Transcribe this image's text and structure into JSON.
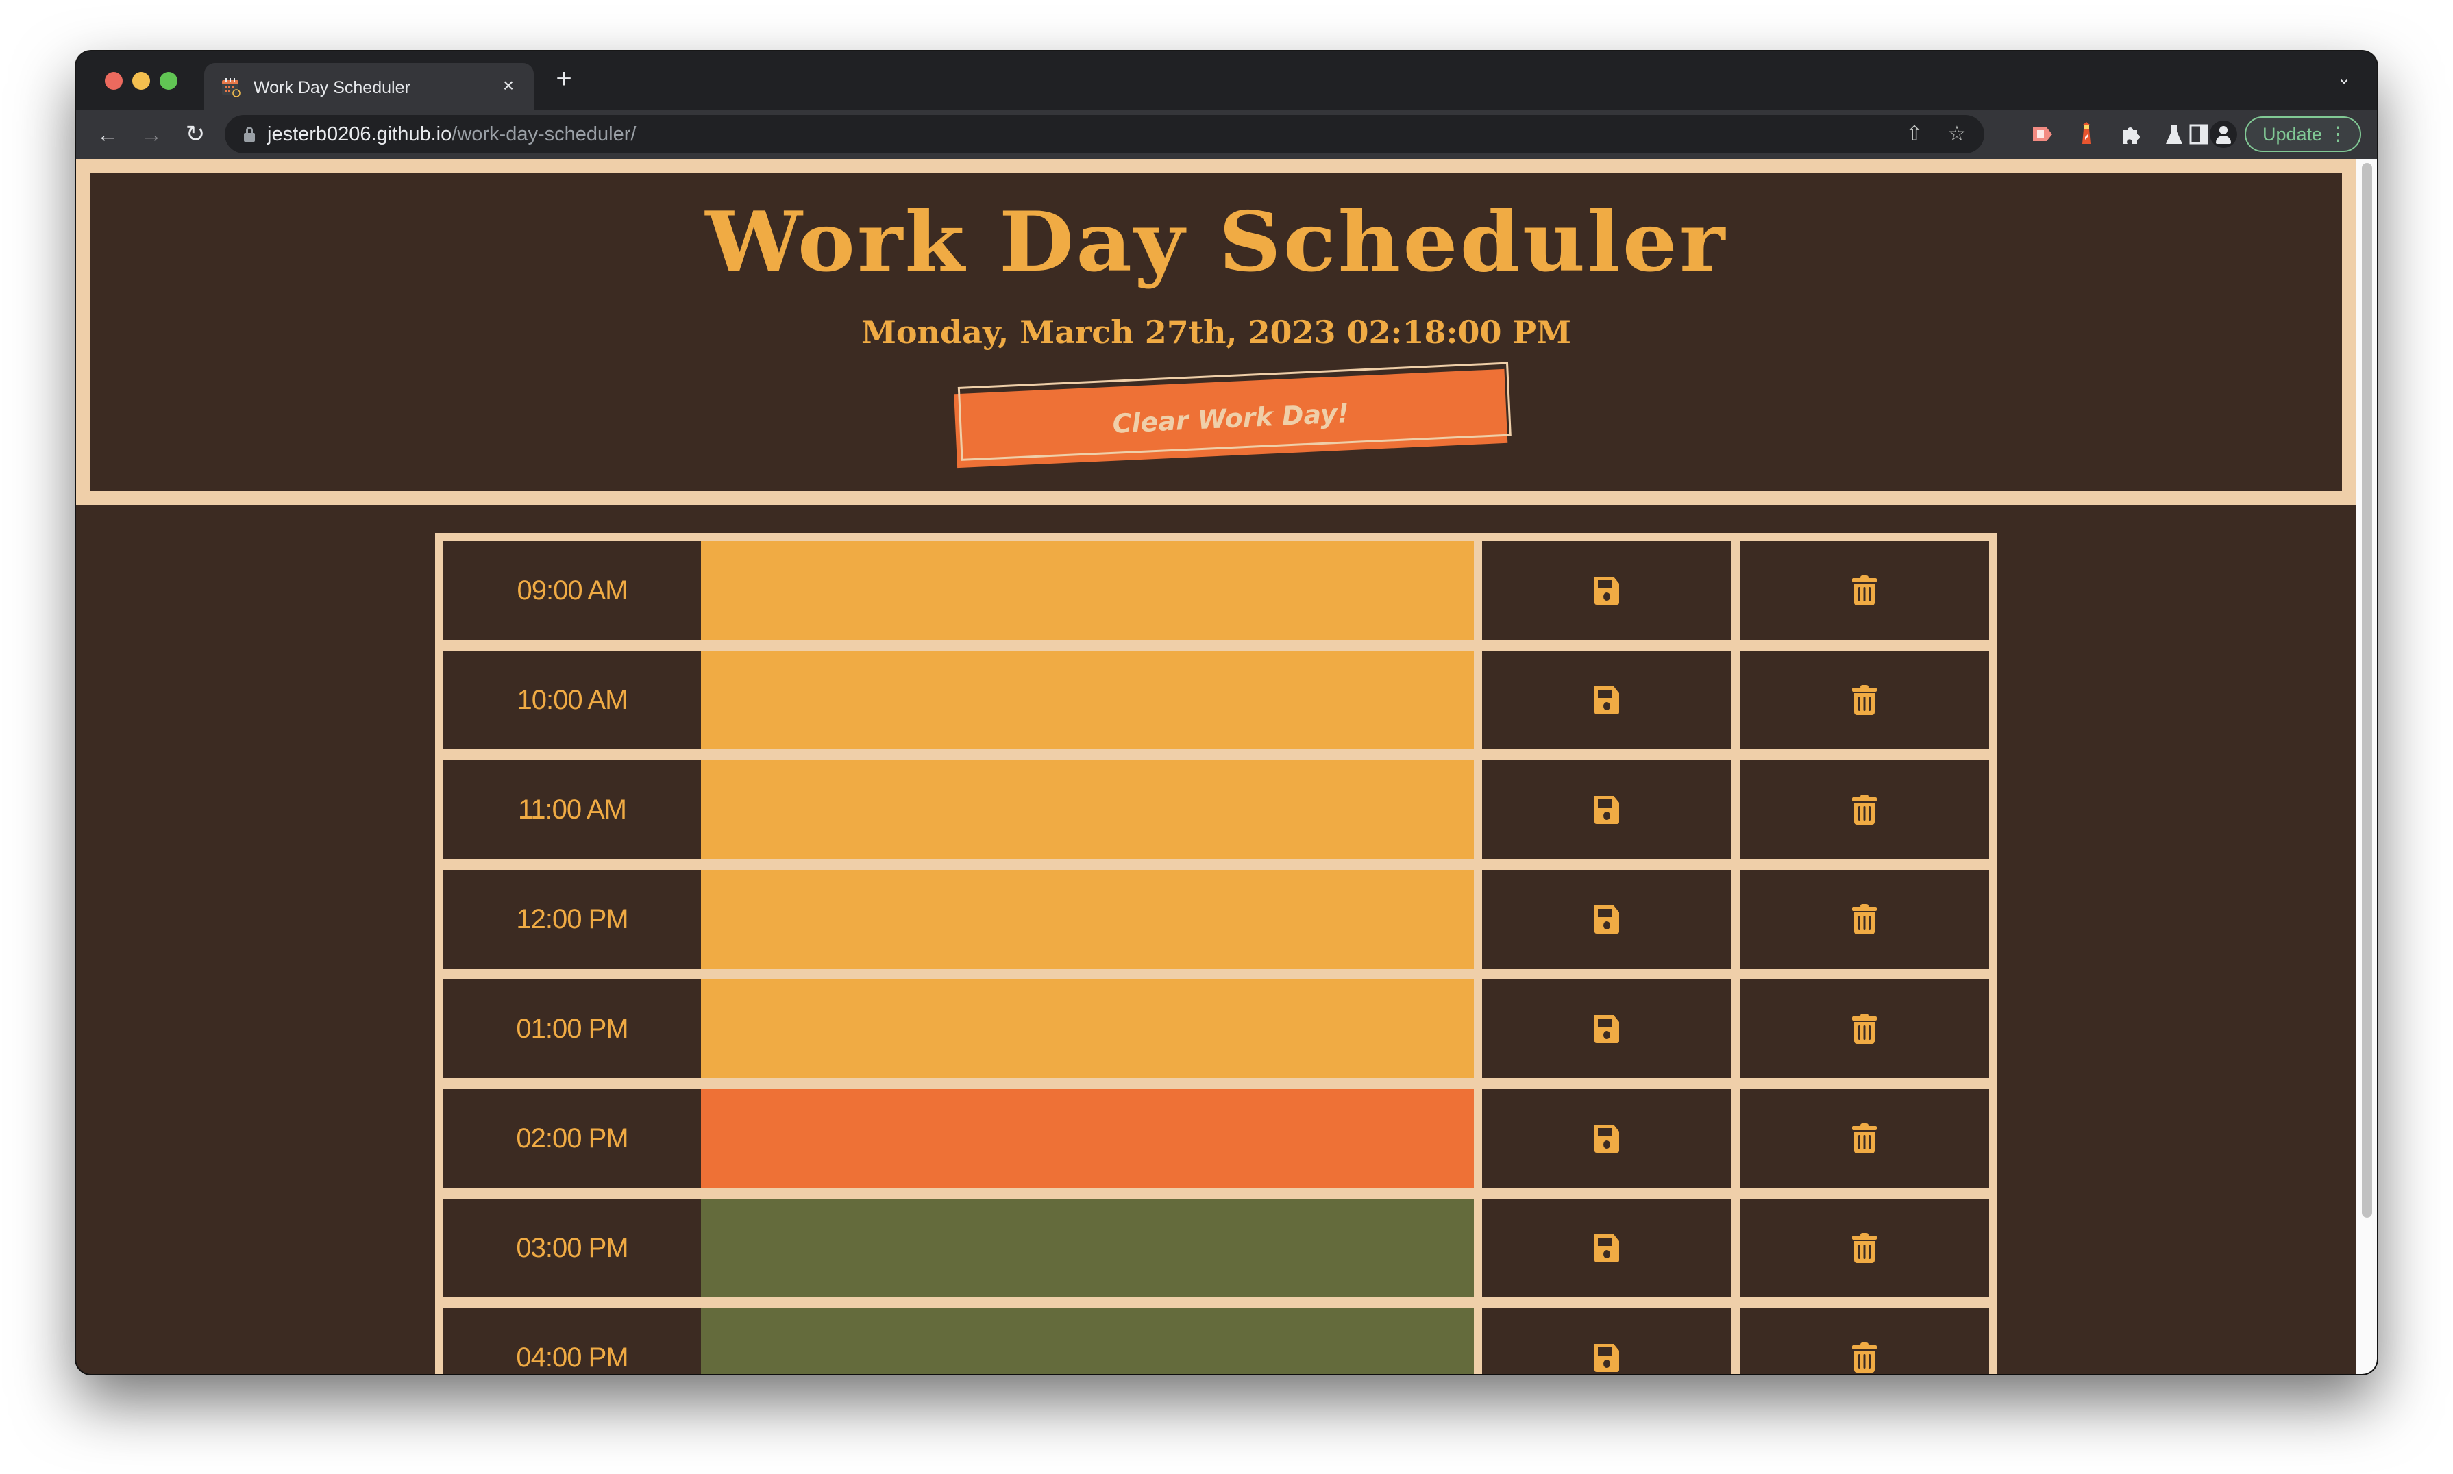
{
  "browser": {
    "tab_title": "Work Day Scheduler",
    "tab_close": "×",
    "new_tab": "+",
    "url_host": "jesterb0206.github.io",
    "url_path": "/work-day-scheduler/",
    "update_label": "Update",
    "icons": {
      "favicon": "calendar-icon",
      "back": "arrow-left-icon",
      "forward": "arrow-right-icon",
      "reload": "reload-icon",
      "lock": "lock-icon",
      "share": "share-icon",
      "bookmark": "star-icon",
      "extensions": [
        "screencast-extension-icon",
        "lighthouse-extension-icon",
        "puzzle-extensions-icon",
        "labs-flask-icon",
        "side-panel-icon",
        "profile-icon"
      ],
      "menu": "kebab-menu-icon",
      "tab_search": "chevron-down-icon"
    }
  },
  "page": {
    "title": "Work Day Scheduler",
    "datetime": "Monday, March 27th, 2023 02:18:00 PM",
    "clear_button": "Clear Work Day!",
    "colors": {
      "background": "#3c2b22",
      "border": "#efcfa9",
      "accent": "#f0ab44",
      "past": "#f0ab44",
      "present": "#ee7136",
      "future": "#646b3c"
    },
    "rows": [
      {
        "hour": "09:00 AM",
        "status": "past",
        "text": ""
      },
      {
        "hour": "10:00 AM",
        "status": "past",
        "text": ""
      },
      {
        "hour": "11:00 AM",
        "status": "past",
        "text": ""
      },
      {
        "hour": "12:00 PM",
        "status": "past",
        "text": ""
      },
      {
        "hour": "01:00 PM",
        "status": "past",
        "text": ""
      },
      {
        "hour": "02:00 PM",
        "status": "present",
        "text": ""
      },
      {
        "hour": "03:00 PM",
        "status": "future",
        "text": ""
      },
      {
        "hour": "04:00 PM",
        "status": "future",
        "text": ""
      }
    ]
  }
}
